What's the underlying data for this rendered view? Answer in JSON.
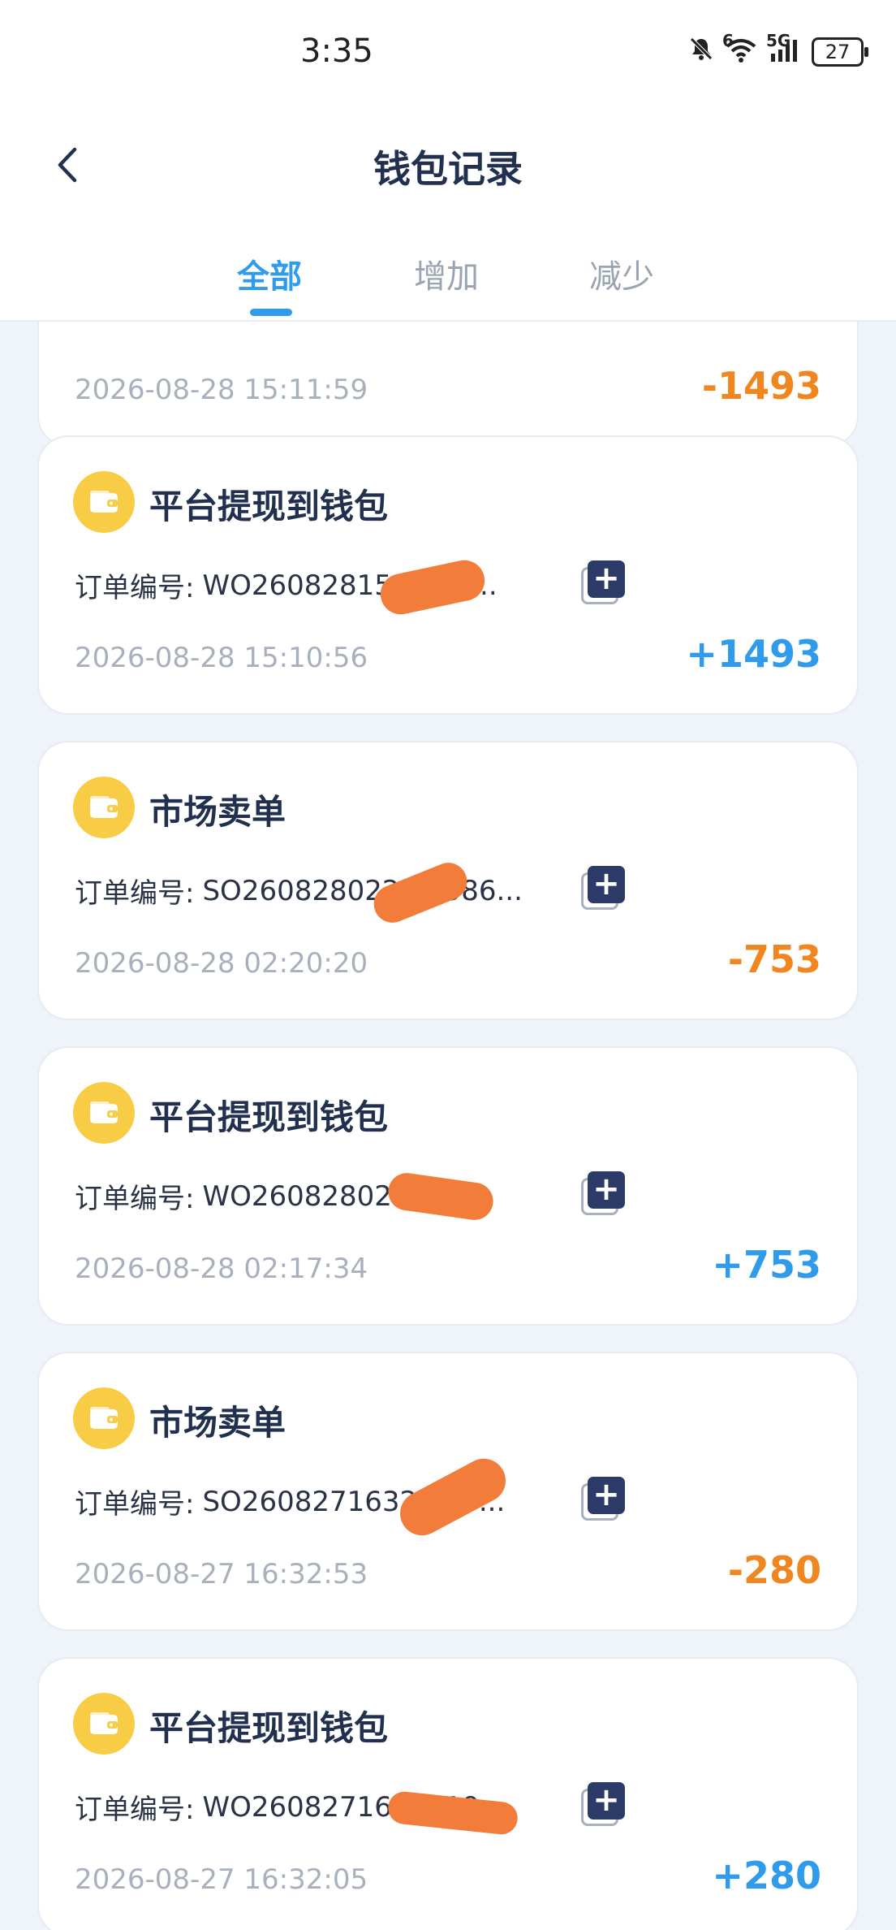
{
  "status_bar": {
    "time": "3:35",
    "signal_5g": "5G",
    "wifi_badge": "6",
    "battery": "27"
  },
  "nav": {
    "title": "钱包记录"
  },
  "tabs": [
    {
      "label": "全部",
      "active": true
    },
    {
      "label": "增加",
      "active": false
    },
    {
      "label": "减少",
      "active": false
    }
  ],
  "records": [
    {
      "title": "",
      "order_label": "",
      "order_id": "",
      "time": "2026-08-28 15:11:59",
      "amount": "-1493",
      "type": "neg"
    },
    {
      "title": "平台提现到钱包",
      "order_label": "订单编号:",
      "order_id": "WO26082815    1374...",
      "time": "2026-08-28 15:10:56",
      "amount": "+1493",
      "type": "pos"
    },
    {
      "title": "市场卖单",
      "order_label": "订单编号:",
      "order_id": "SO2608280220   4586...",
      "time": "2026-08-28 02:20:20",
      "amount": "-753",
      "type": "neg"
    },
    {
      "title": "平台提现到钱包",
      "order_label": "订单编号:",
      "order_id": "WO26082802     018...",
      "time": "2026-08-28 02:17:34",
      "amount": "+753",
      "type": "pos"
    },
    {
      "title": "市场卖单",
      "order_label": "订单编号:",
      "order_id": "SO26082716325   15...",
      "time": "2026-08-27 16:32:53",
      "amount": "-280",
      "type": "neg"
    },
    {
      "title": "平台提现到钱包",
      "order_label": "订单编号:",
      "order_id": "WO260827163   5  19...",
      "time": "2026-08-27 16:32:05",
      "amount": "+280",
      "type": "pos"
    }
  ],
  "colors": {
    "accent": "#2f9bea",
    "negative": "#f08620",
    "icon_bg": "#f8cd45",
    "title": "#22304f"
  },
  "icons": {
    "back": "chevron-left-icon",
    "wallet": "wallet-icon",
    "copy": "copy-plus-icon"
  }
}
